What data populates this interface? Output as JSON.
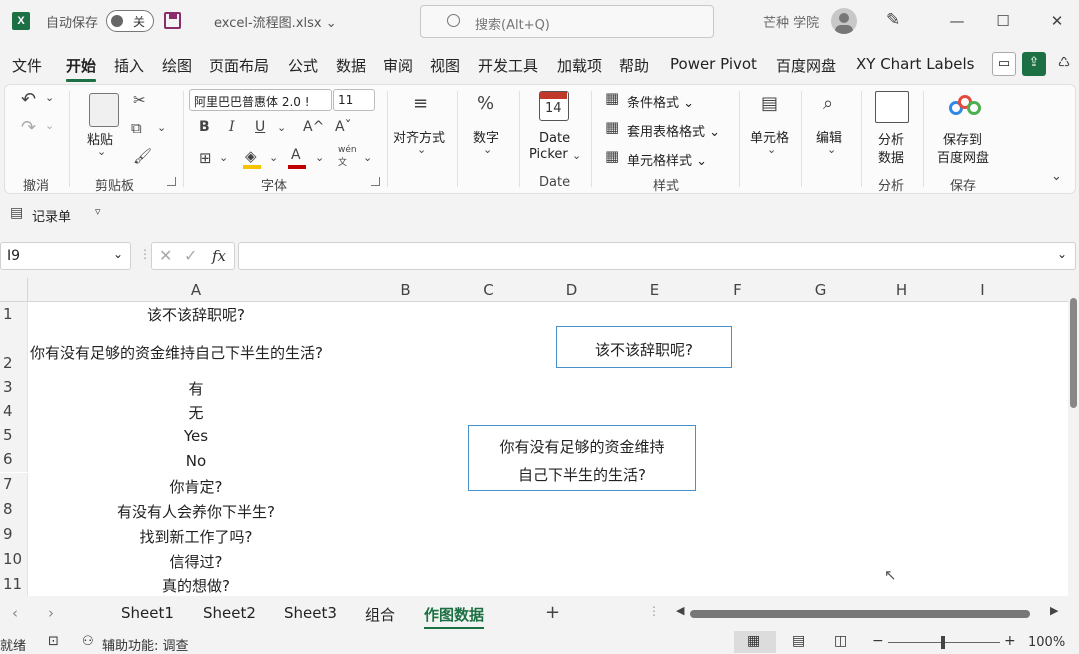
{
  "titlebar": {
    "app_letter": "X",
    "autosave_label": "自动保存",
    "autosave_state": "关",
    "filename": "excel-流程图.xlsx",
    "filename_caret": "⌄",
    "search_placeholder": "搜索(Alt+Q)",
    "user_name": "芒种 学院"
  },
  "menu": {
    "tabs": [
      "文件",
      "开始",
      "插入",
      "绘图",
      "页面布局",
      "公式",
      "数据",
      "审阅",
      "视图",
      "开发工具",
      "加载项",
      "帮助",
      "Power Pivot",
      "百度网盘",
      "XY Chart Labels"
    ],
    "active_tab": "开始"
  },
  "ribbon": {
    "undo": {
      "title": "撤消"
    },
    "clipboard": {
      "paste": "粘贴",
      "title": "剪贴板"
    },
    "font": {
      "name": "阿里巴巴普惠体 2.0 !",
      "size": "11",
      "bold": "B",
      "italic": "I",
      "underline": "U",
      "grow": "A^",
      "shrink": "Aˇ",
      "fill_color": "#f5c400",
      "font_color": "#c00000",
      "phonetic": "wén",
      "phonetic_glyph": "文",
      "title": "字体"
    },
    "alignment": {
      "label": "对齐方式"
    },
    "number": {
      "label": "数字"
    },
    "date": {
      "label1": "Date",
      "label2": "Picker",
      "title": "Date",
      "calendar_day": "14"
    },
    "styles": {
      "cond": "条件格式",
      "table": "套用表格格式",
      "cell": "单元格样式",
      "title": "样式"
    },
    "cells": {
      "label": "单元格"
    },
    "edit": {
      "label": "编辑"
    },
    "analysis": {
      "label1": "分析",
      "label2": "数据",
      "title": "分析"
    },
    "save": {
      "label1": "保存到",
      "label2": "百度网盘",
      "title": "保存"
    }
  },
  "qat": {
    "form_label": "记录单"
  },
  "formula_bar": {
    "name_box": "I9",
    "fx": "fx",
    "value": ""
  },
  "grid": {
    "columns": [
      "A",
      "B",
      "C",
      "D",
      "E",
      "F",
      "G",
      "H",
      "I"
    ],
    "rows": [
      "1",
      "2",
      "3",
      "4",
      "5",
      "6",
      "7",
      "8",
      "9",
      "10",
      "11"
    ],
    "cells_A": [
      "该不该辞职呢?",
      "你有没有足够的资金维持自己下半生的生活?",
      "有",
      "无",
      "Yes",
      "No",
      "你肯定?",
      "有没有人会养你下半生?",
      "找到新工作了吗?",
      "信得过?",
      "真的想做?"
    ]
  },
  "shapes": {
    "box1": "该不该辞职呢?",
    "box2_line1": "你有没有足够的资金维持",
    "box2_line2": "自己下半生的生活?"
  },
  "sheets": {
    "tabs": [
      "Sheet1",
      "Sheet2",
      "Sheet3",
      "组合",
      "作图数据"
    ],
    "active": "作图数据",
    "add": "+"
  },
  "status": {
    "ready": "就绪",
    "accessibility": "辅助功能: 调查",
    "zoom": "100%",
    "minus": "−",
    "plus": "+"
  },
  "colors": {
    "excel_green": "#1d7044",
    "shape_border": "#4a90c8",
    "pin_icon": "#1d7044"
  }
}
